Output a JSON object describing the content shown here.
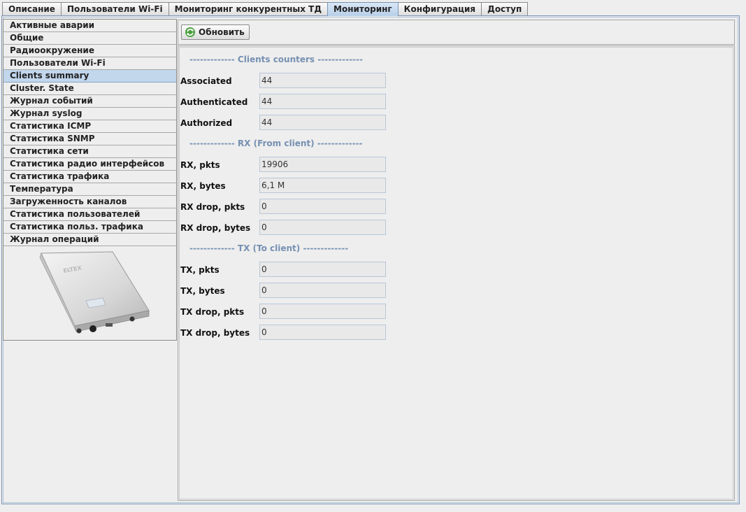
{
  "tabs": [
    {
      "label": "Описание"
    },
    {
      "label": "Пользователи Wi-Fi"
    },
    {
      "label": "Мониторинг конкурентных ТД"
    },
    {
      "label": "Мониторинг"
    },
    {
      "label": "Конфигурация"
    },
    {
      "label": "Доступ"
    }
  ],
  "active_tab": "Мониторинг",
  "sidebar": {
    "items": [
      {
        "label": "Активные аварии"
      },
      {
        "label": "Общие"
      },
      {
        "label": "Радиоокружение"
      },
      {
        "label": "Пользователи Wi-Fi"
      },
      {
        "label": "Clients summary"
      },
      {
        "label": "Cluster. State"
      },
      {
        "label": "Журнал событий"
      },
      {
        "label": "Журнал syslog"
      },
      {
        "label": "Статистика ICMP"
      },
      {
        "label": "Статистика SNMP"
      },
      {
        "label": "Статистика сети"
      },
      {
        "label": "Статистика радио интерфейсов"
      },
      {
        "label": "Статистика трафика"
      },
      {
        "label": "Температура"
      },
      {
        "label": "Загруженность каналов"
      },
      {
        "label": "Статистика пользователей"
      },
      {
        "label": "Статистика польз. трафика"
      },
      {
        "label": "Журнал операций"
      }
    ],
    "selected": "Clients summary",
    "device_logo_text": "ELTEX"
  },
  "toolbar": {
    "refresh_label": "Обновить",
    "refresh_icon": "refresh-icon"
  },
  "sections": {
    "counters": "------------- Clients counters -------------",
    "rx": "------------- RX (From client) -------------",
    "tx": "------------- TX (To client) -------------"
  },
  "fields": {
    "associated": {
      "label": "Associated",
      "value": "44"
    },
    "authenticated": {
      "label": "Authenticated",
      "value": "44"
    },
    "authorized": {
      "label": "Authorized",
      "value": "44"
    },
    "rx_pkts": {
      "label": "RX, pkts",
      "value": "19906"
    },
    "rx_bytes": {
      "label": "RX, bytes",
      "value": "6,1 M"
    },
    "rx_drop_pkts": {
      "label": "RX drop, pkts",
      "value": "0"
    },
    "rx_drop_bytes": {
      "label": "RX drop, bytes",
      "value": "0"
    },
    "tx_pkts": {
      "label": "TX, pkts",
      "value": "0"
    },
    "tx_bytes": {
      "label": "TX, bytes",
      "value": "0"
    },
    "tx_drop_pkts": {
      "label": "TX drop, pkts",
      "value": "0"
    },
    "tx_drop_bytes": {
      "label": "TX drop, bytes",
      "value": "0"
    }
  },
  "colors": {
    "accent": "#7690b2",
    "selected": "#c2d6ec",
    "tab_active": "#b7cfe9"
  }
}
